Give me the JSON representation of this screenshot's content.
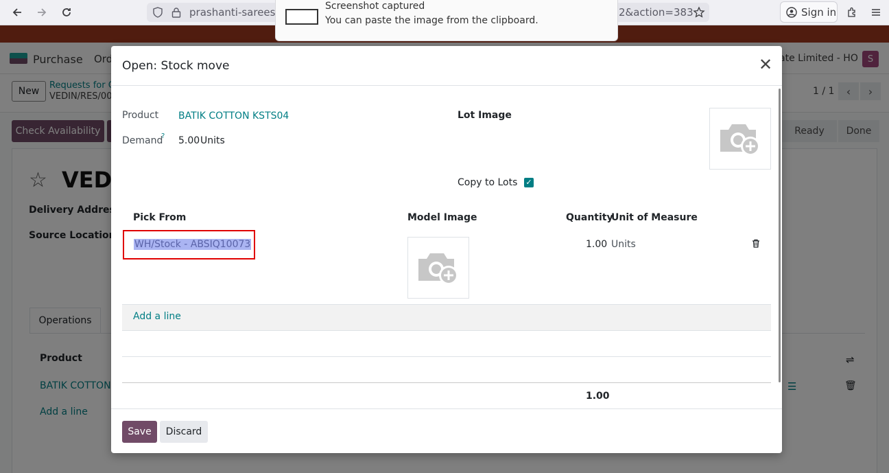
{
  "browser": {
    "url_left": "prashanti-sarees-s",
    "url_right": "2&action=383",
    "signin_label": "Sign in"
  },
  "notification": {
    "title": "Screenshot captured",
    "subtitle": "You can paste the image from the clipboard."
  },
  "app": {
    "name": "Purchase",
    "menu_item": "Ord",
    "company": "ate Limited - HO",
    "avatar_letter": "S"
  },
  "control_panel": {
    "new_label": "New",
    "breadcrumb_parent": "Requests for Q",
    "breadcrumb_current": "VEDIN/RES/00",
    "pager": "1 / 1"
  },
  "status": {
    "check_availability_label": "Check Availability",
    "stages": [
      "Ready",
      "Done"
    ]
  },
  "record": {
    "title": "VEDI",
    "delivery_address_label": "Delivery Address",
    "source_location_label": "Source Location",
    "tab_operations": "Operations",
    "col_product": "Product",
    "product_value": "BATIK COTTON K",
    "add_line": "Add a line"
  },
  "modal": {
    "title": "Open: Stock move",
    "product_label": "Product",
    "product_value": "BATIK COTTON KSTS04",
    "demand_label": "Demand",
    "demand_help": "?",
    "demand_value": "5.00",
    "demand_unit": "Units",
    "lot_image_label": "Lot Image",
    "copy_to_lots_label": "Copy to Lots",
    "copy_to_lots_checked": true,
    "columns": {
      "pick_from": "Pick From",
      "model_image": "Model Image",
      "quantity": "Quantity",
      "uom": "Unit of Measure"
    },
    "line": {
      "pick_from": "WH/Stock - ABSIQ10073",
      "quantity": "1.00",
      "uom": "Units"
    },
    "add_line": "Add a line",
    "total_quantity": "1.00",
    "save_label": "Save",
    "discard_label": "Discard"
  },
  "colors": {
    "primary": "#714b67",
    "link": "#017e84",
    "highlight_border": "#e00000",
    "selection": "#aab4f2"
  }
}
